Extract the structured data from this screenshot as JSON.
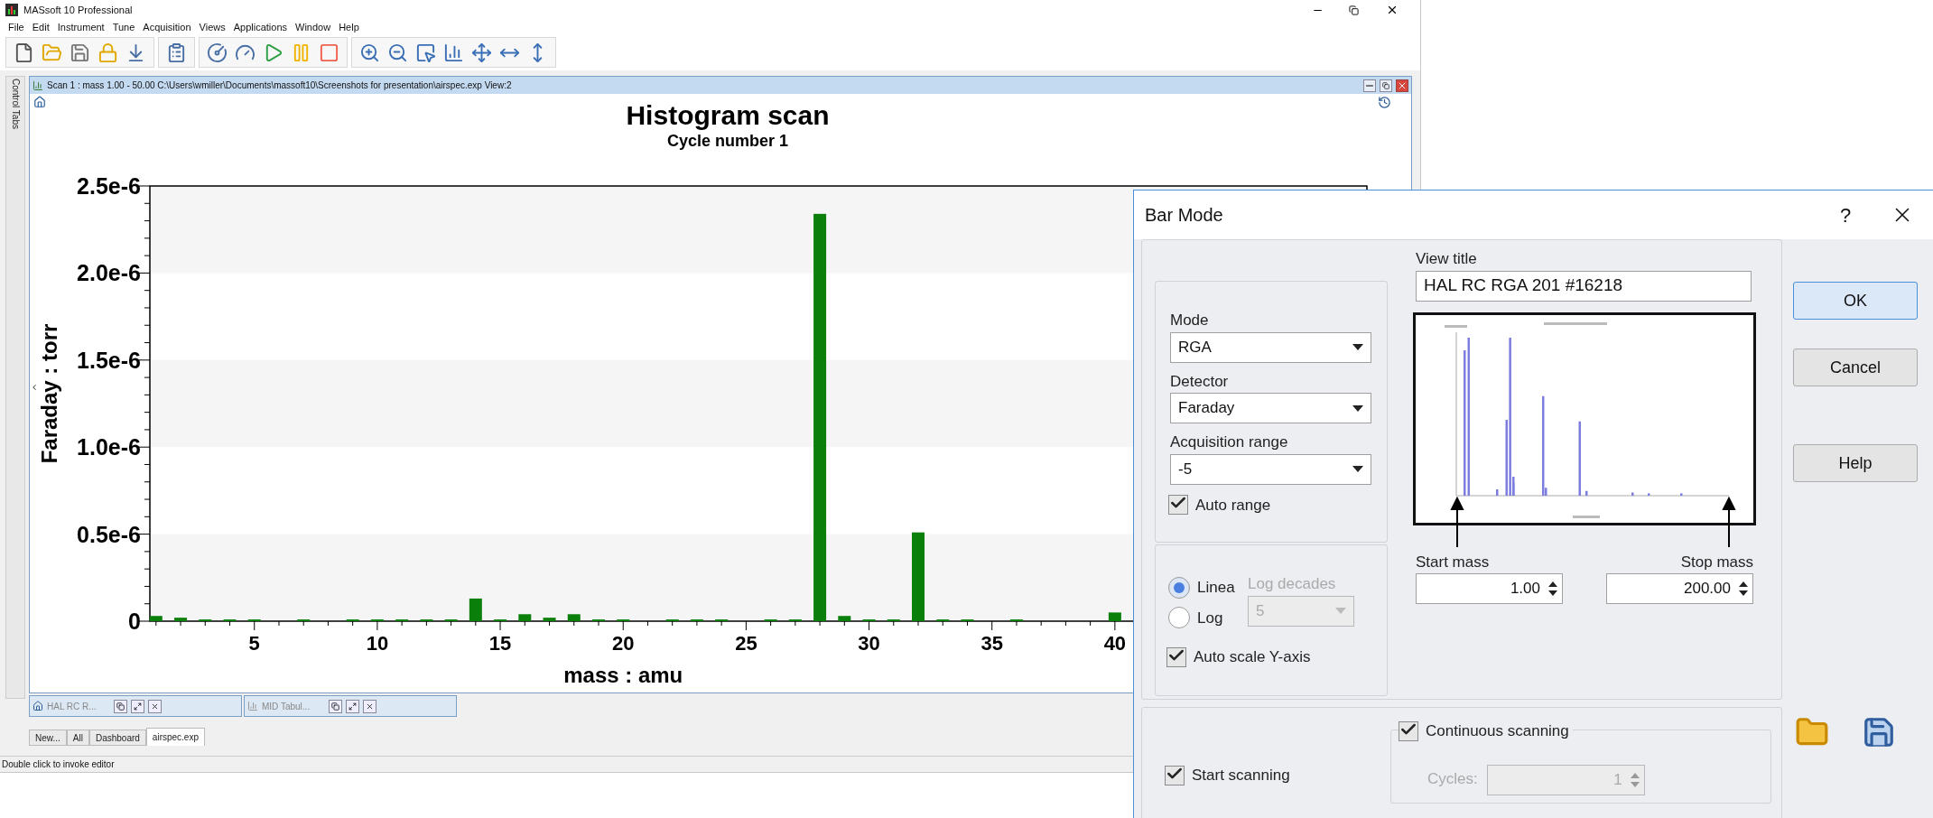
{
  "app": {
    "title": "MASsoft 10 Professional"
  },
  "menu": [
    "File",
    "Edit",
    "Instrument",
    "Tune",
    "Acquisition",
    "Views",
    "Applications",
    "Window",
    "Help"
  ],
  "control_tabs": "Control Tabs",
  "scan_window": {
    "title": "Scan 1 : mass 1.00 - 50.00 C:\\Users\\wmiller\\Documents\\massoft10\\Screenshots for presentation\\airspec.exp View:2",
    "subtitle": "Cycle number 1",
    "chart_data": {
      "type": "bar",
      "title": "Histogram scan",
      "xlabel": "mass : amu",
      "ylabel": "Faraday : torr",
      "x": [
        1,
        2,
        3,
        4,
        5,
        6,
        7,
        8,
        9,
        10,
        11,
        12,
        13,
        14,
        15,
        16,
        17,
        18,
        19,
        20,
        21,
        22,
        23,
        24,
        25,
        26,
        27,
        28,
        29,
        30,
        31,
        32,
        33,
        34,
        35,
        36,
        37,
        38,
        39,
        40
      ],
      "series": [
        {
          "color": "#0a800a",
          "values": [
            3e-08,
            2e-08,
            1e-08,
            1e-08,
            1e-08,
            0,
            1e-08,
            0,
            1e-08,
            1e-08,
            1e-08,
            1e-08,
            1e-08,
            1.3e-07,
            1e-08,
            4e-08,
            2e-08,
            4e-08,
            1e-08,
            1e-08,
            0,
            1e-08,
            1e-08,
            1e-08,
            0,
            1e-08,
            1e-08,
            2.34e-06,
            3e-08,
            1e-08,
            1e-08,
            5.1e-07,
            1e-08,
            1e-08,
            0,
            1e-08,
            0,
            0,
            0,
            5e-08
          ]
        }
      ],
      "xlim": [
        0.75,
        50.25
      ],
      "ylim": [
        0,
        2.5e-06
      ],
      "xticks": [
        5,
        10,
        15,
        20,
        25,
        30,
        35,
        40
      ],
      "yticks": [
        {
          "value": 0,
          "label": "0"
        },
        {
          "value": 5e-07,
          "label": "0.5e-6"
        },
        {
          "value": 1e-06,
          "label": "1.0e-6"
        },
        {
          "value": 1.5e-06,
          "label": "1.5e-6"
        },
        {
          "value": 2e-06,
          "label": "2.0e-6"
        },
        {
          "value": 2.5e-06,
          "label": "2.5e-6"
        }
      ]
    }
  },
  "minimized_windows": [
    {
      "title": "HAL RC R..."
    },
    {
      "title": "MID Tabul..."
    }
  ],
  "tabs": [
    {
      "label": "New...",
      "selected": false
    },
    {
      "label": "All",
      "selected": false
    },
    {
      "label": "Dashboard",
      "selected": false
    },
    {
      "label": "airspec.exp",
      "selected": true
    }
  ],
  "status_bar": {
    "text": "Double click to invoke editor"
  },
  "dialog": {
    "title": "Bar Mode",
    "help": "?",
    "mode": {
      "label": "Mode",
      "value": "RGA"
    },
    "detector": {
      "label": "Detector",
      "value": "Faraday"
    },
    "acquisition_range": {
      "label": "Acquisition range",
      "value": "-5"
    },
    "auto_range": {
      "label": "Auto range",
      "checked": true
    },
    "scale": [
      {
        "label": "Linea",
        "selected": true
      },
      {
        "label": "Log",
        "selected": false
      }
    ],
    "log_decades": {
      "label": "Log decades",
      "value": "5",
      "disabled": true
    },
    "auto_scale": {
      "label": "Auto scale Y-axis",
      "checked": true
    },
    "view_title": {
      "label": "View title",
      "value": "HAL RC RGA 201 #16218"
    },
    "start_mass": {
      "label": "Start mass",
      "value": "1.00"
    },
    "stop_mass": {
      "label": "Stop mass",
      "value": "200.00"
    },
    "start_scanning": {
      "label": "Start scanning",
      "checked": true
    },
    "continuous_scanning": {
      "label": "Continuous scanning",
      "checked": true
    },
    "cycles": {
      "label": "Cycles:",
      "value": "1",
      "disabled": true
    },
    "buttons": [
      {
        "label": "OK",
        "selected": true
      },
      {
        "label": "Cancel",
        "selected": false
      },
      {
        "label": "Help",
        "selected": false
      }
    ]
  }
}
